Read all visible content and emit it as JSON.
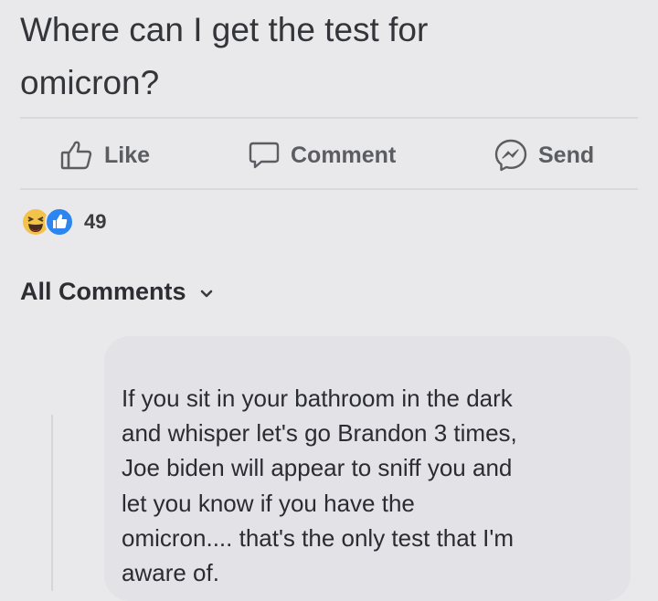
{
  "post": {
    "text": "Where can I get the test for\nomicron?"
  },
  "actions": {
    "like_label": "Like",
    "comment_label": "Comment",
    "send_label": "Send"
  },
  "reactions": {
    "count": "49",
    "icons": [
      "haha-icon",
      "like-icon"
    ]
  },
  "comments_filter": {
    "label": "All Comments"
  },
  "comment": {
    "text": "If you sit in your bathroom in the dark\nand whisper let's go Brandon 3 times,\nJoe biden will appear to sniff you and\nlet you know if you have the\nomicron.... that's the only test that I'm\naware of."
  },
  "colors": {
    "background": "#e9e8ea",
    "bubble": "#e3e2e6",
    "like_blue": "#2d86f0",
    "haha_yellow": "#f3c24a"
  }
}
